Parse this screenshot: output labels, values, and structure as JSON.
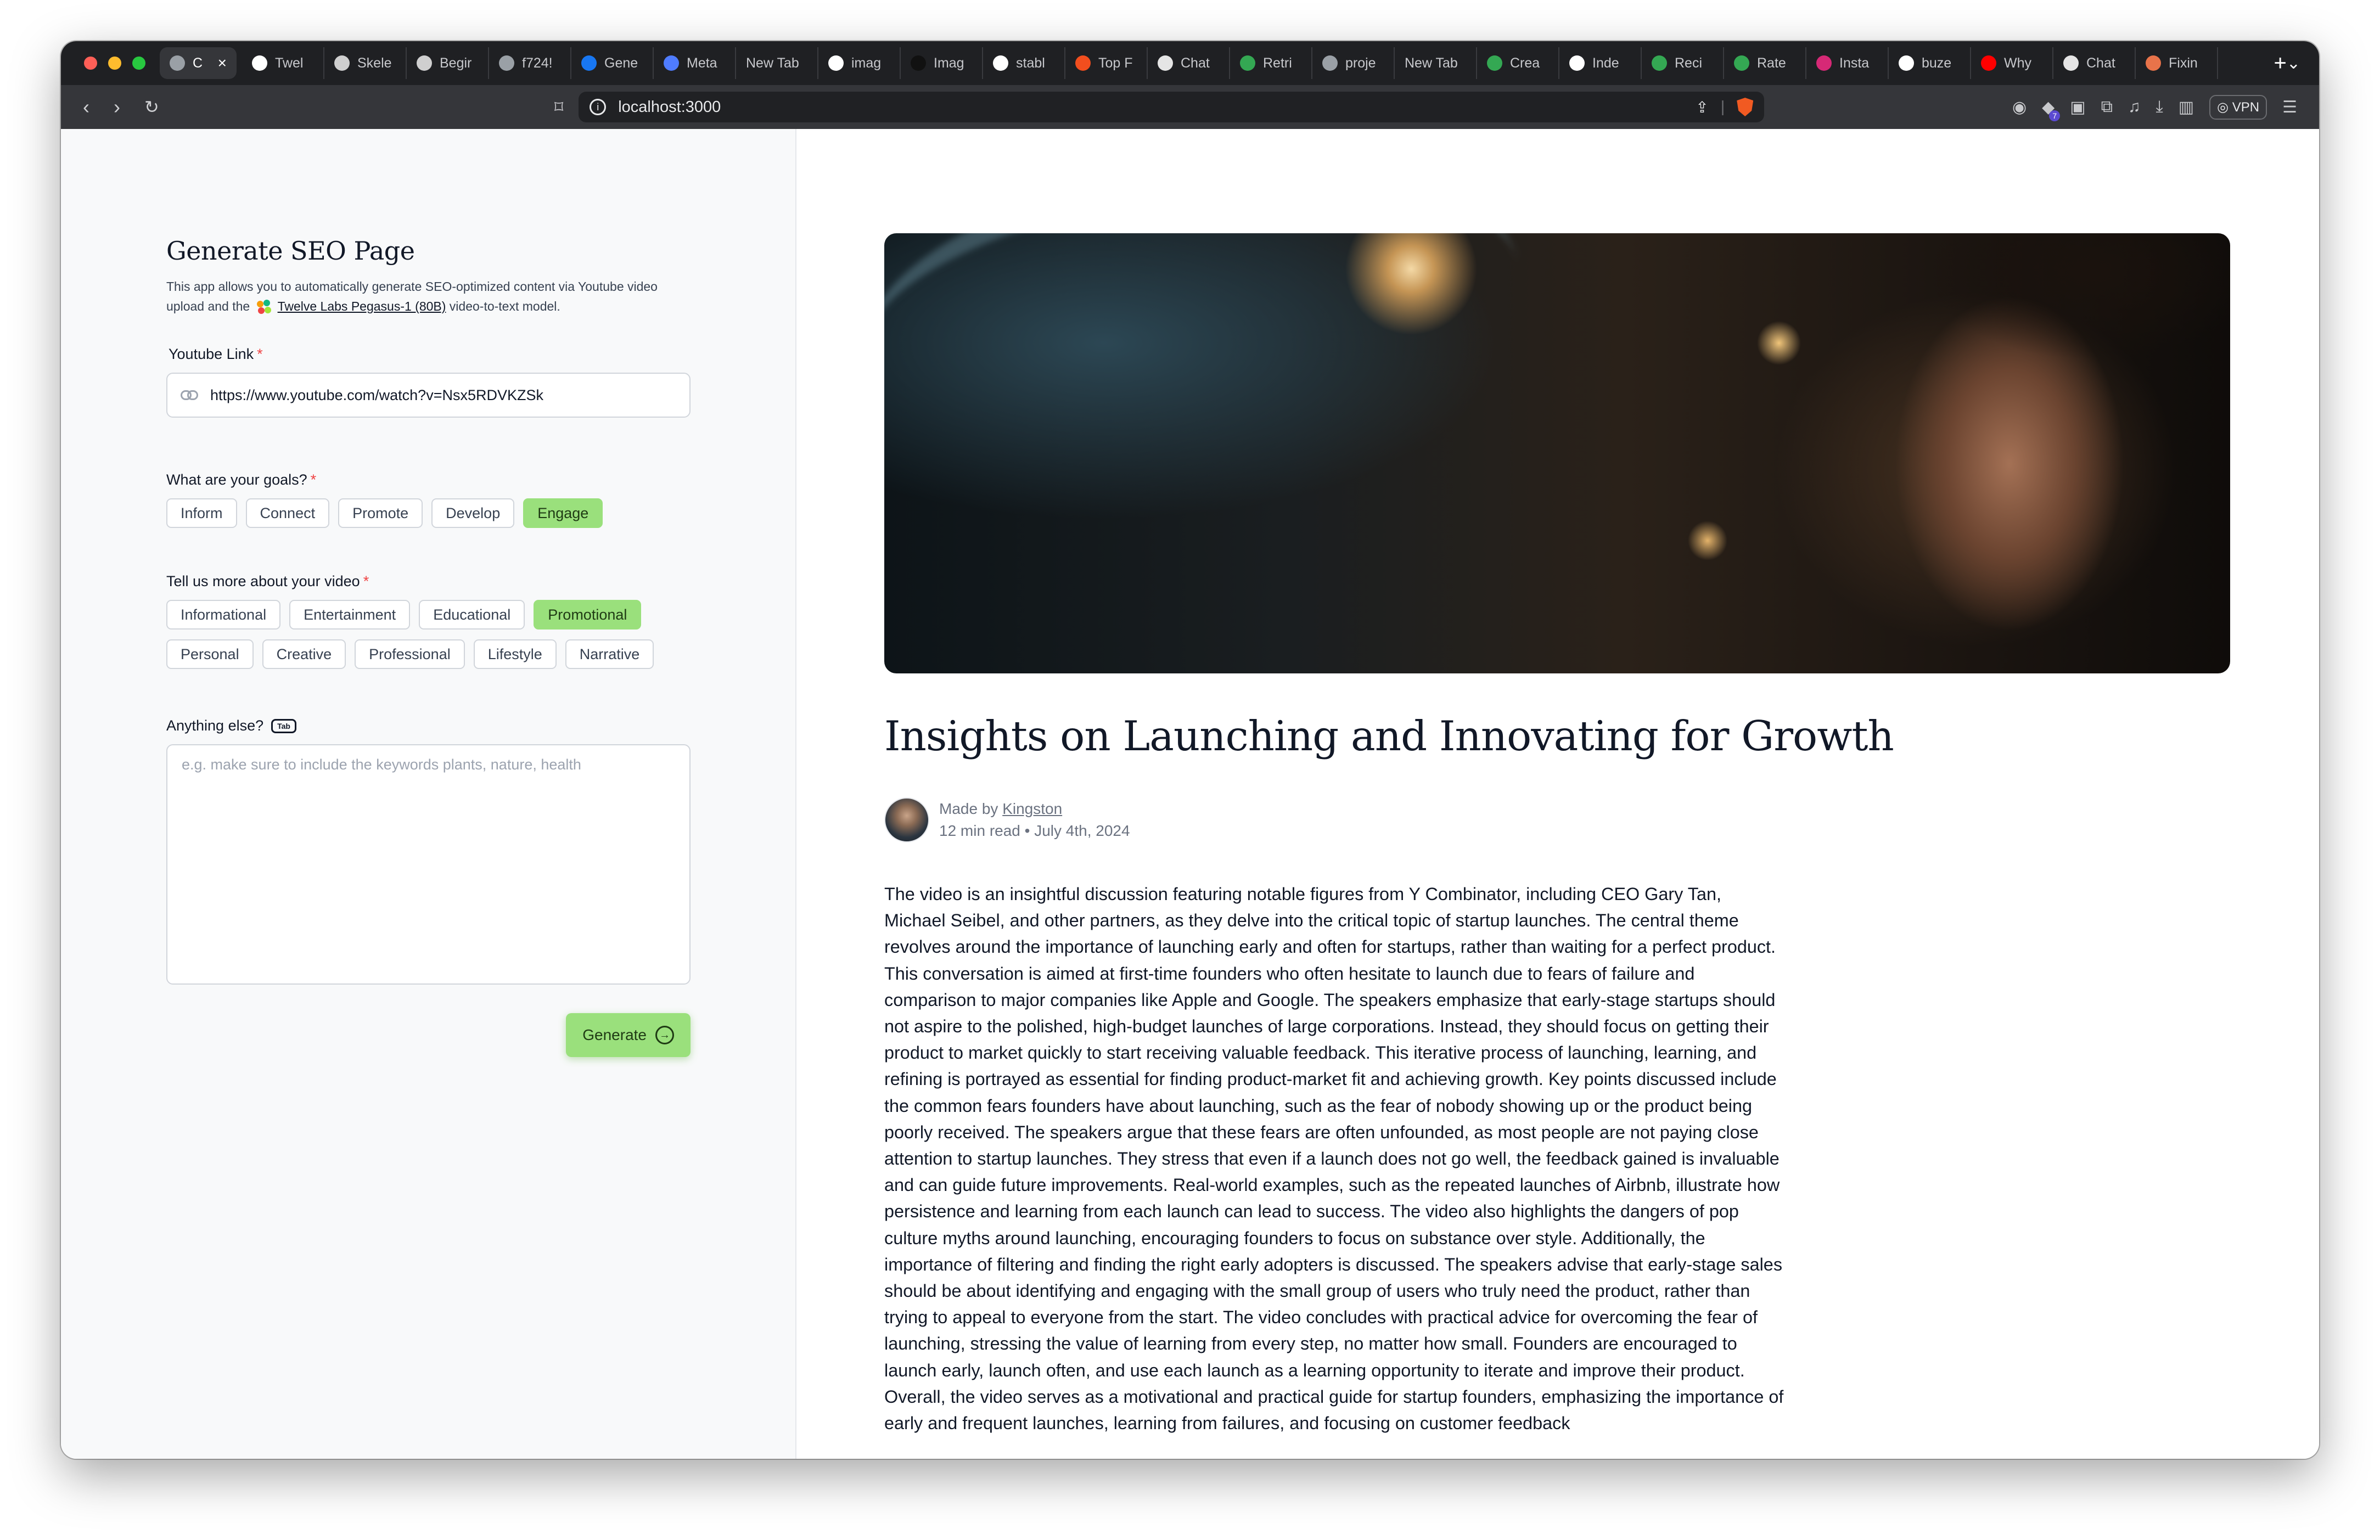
{
  "browser": {
    "tabs": [
      {
        "label": "C",
        "active": true,
        "icon": "globe-icon"
      },
      {
        "label": "Twel",
        "icon": "x-logo-icon"
      },
      {
        "label": "Skele",
        "icon": "ui-icon"
      },
      {
        "label": "Begir",
        "icon": "gear-icon"
      },
      {
        "label": "f724!",
        "icon": "globe-icon"
      },
      {
        "label": "Gene",
        "icon": "meta-icon"
      },
      {
        "label": "Meta",
        "icon": "circle-icon"
      },
      {
        "label": "New Tab",
        "icon": ""
      },
      {
        "label": "imag",
        "icon": "google-icon"
      },
      {
        "label": "Imag",
        "icon": "dark-icon"
      },
      {
        "label": "stabl",
        "icon": "google-icon"
      },
      {
        "label": "Top F",
        "icon": "figma-icon"
      },
      {
        "label": "Chat",
        "icon": "openai-icon"
      },
      {
        "label": "Retri",
        "icon": "dots-icon"
      },
      {
        "label": "proje",
        "icon": "globe-icon"
      },
      {
        "label": "New Tab",
        "icon": ""
      },
      {
        "label": "Crea",
        "icon": "dots-icon"
      },
      {
        "label": "Inde",
        "icon": "google-icon"
      },
      {
        "label": "Reci",
        "icon": "dots-icon"
      },
      {
        "label": "Rate",
        "icon": "dots-icon"
      },
      {
        "label": "Insta",
        "icon": "instagram-icon"
      },
      {
        "label": "buze",
        "icon": "google-icon"
      },
      {
        "label": "Why",
        "icon": "youtube-icon"
      },
      {
        "label": "Chat",
        "icon": "openai-icon"
      },
      {
        "label": "Fixin",
        "icon": "sparkle-icon"
      }
    ],
    "url": "localhost:3000",
    "vpn_label": "VPN",
    "extension_badge": "7"
  },
  "form": {
    "title": "Generate SEO Page",
    "description_before": "This app allows you to automatically generate SEO-optimized content via Youtube video upload and the",
    "description_link": "Twelve Labs Pegasus-1 (80B)",
    "description_after": "video-to-text model.",
    "youtube_label": "Youtube Link",
    "youtube_value": "https://www.youtube.com/watch?v=Nsx5RDVKZSk",
    "goals_label": "What are your goals?",
    "goals": [
      {
        "label": "Inform",
        "selected": false
      },
      {
        "label": "Connect",
        "selected": false
      },
      {
        "label": "Promote",
        "selected": false
      },
      {
        "label": "Develop",
        "selected": false
      },
      {
        "label": "Engage",
        "selected": true
      }
    ],
    "video_label": "Tell us more about your video",
    "video_types_row1": [
      {
        "label": "Informational",
        "selected": false
      },
      {
        "label": "Entertainment",
        "selected": false
      },
      {
        "label": "Educational",
        "selected": false
      },
      {
        "label": "Promotional",
        "selected": true
      }
    ],
    "video_types_row2": [
      {
        "label": "Personal",
        "selected": false
      },
      {
        "label": "Creative",
        "selected": false
      },
      {
        "label": "Professional",
        "selected": false
      },
      {
        "label": "Lifestyle",
        "selected": false
      },
      {
        "label": "Narrative",
        "selected": false
      }
    ],
    "else_label": "Anything else?",
    "tab_key_label": "Tab",
    "else_placeholder": "e.g. make sure to include the keywords plants, nature, health",
    "generate_label": "Generate"
  },
  "article": {
    "title": "Insights on Launching and Innovating for Growth",
    "made_by_prefix": "Made by",
    "author": "Kingston",
    "meta": "12 min read • July 4th, 2024",
    "body": "The video is an insightful discussion featuring notable figures from Y Combinator, including CEO Gary Tan, Michael Seibel, and other partners, as they delve into the critical topic of startup launches. The central theme revolves around the importance of launching early and often for startups, rather than waiting for a perfect product. This conversation is aimed at first-time founders who often hesitate to launch due to fears of failure and comparison to major companies like Apple and Google. The speakers emphasize that early-stage startups should not aspire to the polished, high-budget launches of large corporations. Instead, they should focus on getting their product to market quickly to start receiving valuable feedback. This iterative process of launching, learning, and refining is portrayed as essential for finding product-market fit and achieving growth. Key points discussed include the common fears founders have about launching, such as the fear of nobody showing up or the product being poorly received. The speakers argue that these fears are often unfounded, as most people are not paying close attention to startup launches. They stress that even if a launch does not go well, the feedback gained is invaluable and can guide future improvements. Real-world examples, such as the repeated launches of Airbnb, illustrate how persistence and learning from each launch can lead to success. The video also highlights the dangers of pop culture myths around launching, encouraging founders to focus on substance over style. Additionally, the importance of filtering and finding the right early adopters is discussed. The speakers advise that early-stage sales should be about identifying and engaging with the small group of users who truly need the product, rather than trying to appeal to everyone from the start. The video concludes with practical advice for overcoming the fear of launching, stressing the value of learning from every step, no matter how small. Founders are encouraged to launch early, launch often, and use each launch as a learning opportunity to iterate and improve their product. Overall, the video serves as a motivational and practical guide for startup founders, emphasizing the importance of early and frequent launches, learning from failures, and focusing on customer feedback"
  },
  "colors": {
    "accent_green": "#9ae07c",
    "required_red": "#ef4444",
    "tabbar_bg": "#1f2023",
    "toolbar_bg": "#35363a"
  }
}
